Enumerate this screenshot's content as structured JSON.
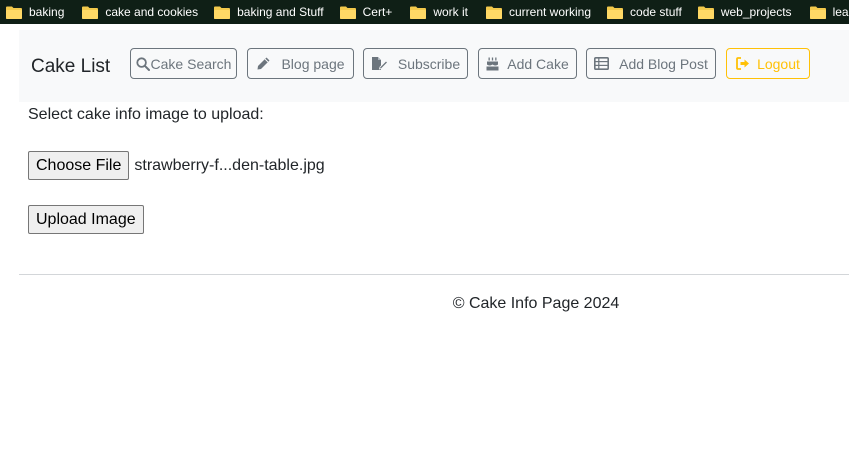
{
  "bookmarks": [
    {
      "label": "baking",
      "icon": "folder-icon"
    },
    {
      "label": "cake and cookies",
      "icon": "folder-icon"
    },
    {
      "label": "baking and Stuff",
      "icon": "folder-icon"
    },
    {
      "label": "Cert+",
      "icon": "folder-icon"
    },
    {
      "label": "work it",
      "icon": "folder-icon"
    },
    {
      "label": "current working",
      "icon": "folder-icon"
    },
    {
      "label": "code stuff",
      "icon": "folder-icon"
    },
    {
      "label": "web_projects",
      "icon": "folder-icon"
    },
    {
      "label": "lea",
      "icon": "folder-icon"
    }
  ],
  "navbar": {
    "brand": "Cake List",
    "buttons": [
      {
        "label": "Cake Search",
        "icon": "search-icon"
      },
      {
        "label": "Blog page",
        "icon": "pencil-icon"
      },
      {
        "label": "Subscribe",
        "icon": "file-signature-icon"
      },
      {
        "label": "Add Cake",
        "icon": "birthday-cake-icon"
      },
      {
        "label": "Add Blog Post",
        "icon": "list-table-icon"
      },
      {
        "label": "Logout",
        "icon": "sign-out-icon"
      }
    ]
  },
  "upload_form": {
    "label": "Select cake info image to upload:",
    "choose_file_label": "Choose File",
    "file_name": "strawberry-f...den-table.jpg",
    "upload_label": "Upload Image"
  },
  "footer": {
    "text": "© Cake Info Page 2024"
  },
  "colors": {
    "bookmark_bar": "#0f1f16",
    "folder": "#f2c94c",
    "navbar_bg": "#f8f9fa",
    "secondary": "#6c757d",
    "warning": "#ffc107"
  }
}
